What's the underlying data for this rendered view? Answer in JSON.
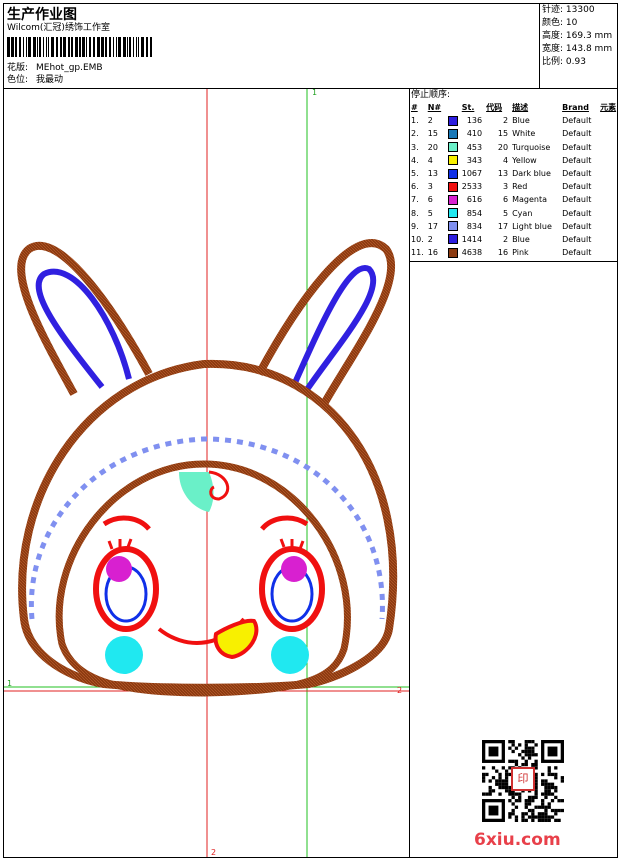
{
  "header": {
    "title": "生产作业图",
    "software": "Wilcom(汇冠)绣饰工作室",
    "design_label": "花版:",
    "design_file": "MEhot_gp.EMB",
    "color_label": "色位:",
    "color_value": "我最动"
  },
  "stats": [
    {
      "label": "针迹:",
      "value": "13300"
    },
    {
      "label": "颜色:",
      "value": "10"
    },
    {
      "label": "高度:",
      "value": "169.3 mm"
    },
    {
      "label": "宽度:",
      "value": "143.8 mm"
    },
    {
      "label": "比例:",
      "value": "0.93"
    }
  ],
  "stop_sequence": {
    "title": "停止顺序:",
    "headers": [
      "#",
      "N#",
      "St.",
      "代码",
      "描述",
      "Brand",
      "元素"
    ],
    "rows": [
      {
        "idx": "1.",
        "n": "2",
        "st": "136",
        "code": "2",
        "desc": "Blue",
        "brand": "Default",
        "color": "#2d1ee0"
      },
      {
        "idx": "2.",
        "n": "15",
        "st": "410",
        "code": "15",
        "desc": "White",
        "brand": "Default",
        "color": "#1878b8"
      },
      {
        "idx": "3.",
        "n": "20",
        "st": "453",
        "code": "20",
        "desc": "Turquoise",
        "brand": "Default",
        "color": "#6af0c8"
      },
      {
        "idx": "4.",
        "n": "4",
        "st": "343",
        "code": "4",
        "desc": "Yellow",
        "brand": "Default",
        "color": "#f8f000"
      },
      {
        "idx": "5.",
        "n": "13",
        "st": "1067",
        "code": "13",
        "desc": "Dark blue",
        "brand": "Default",
        "color": "#1030e8"
      },
      {
        "idx": "6.",
        "n": "3",
        "st": "2533",
        "code": "3",
        "desc": "Red",
        "brand": "Default",
        "color": "#f01010"
      },
      {
        "idx": "7.",
        "n": "6",
        "st": "616",
        "code": "6",
        "desc": "Magenta",
        "brand": "Default",
        "color": "#d820d0"
      },
      {
        "idx": "8.",
        "n": "5",
        "st": "854",
        "code": "5",
        "desc": "Cyan",
        "brand": "Default",
        "color": "#20e8f0"
      },
      {
        "idx": "9.",
        "n": "17",
        "st": "834",
        "code": "17",
        "desc": "Light blue",
        "brand": "Default",
        "color": "#8090f0"
      },
      {
        "idx": "10.",
        "n": "2",
        "st": "1414",
        "code": "2",
        "desc": "Blue",
        "brand": "Default",
        "color": "#2d1ee0"
      },
      {
        "idx": "11.",
        "n": "16",
        "st": "4638",
        "code": "16",
        "desc": "Pink",
        "brand": "Default",
        "color": "#8b3a10"
      }
    ]
  },
  "guides": {
    "v_red_label": "2",
    "v_green_label": "1",
    "h_green_label": "1",
    "h_red_label": "2"
  },
  "watermark": "6xiu.com",
  "seal_text": "印"
}
